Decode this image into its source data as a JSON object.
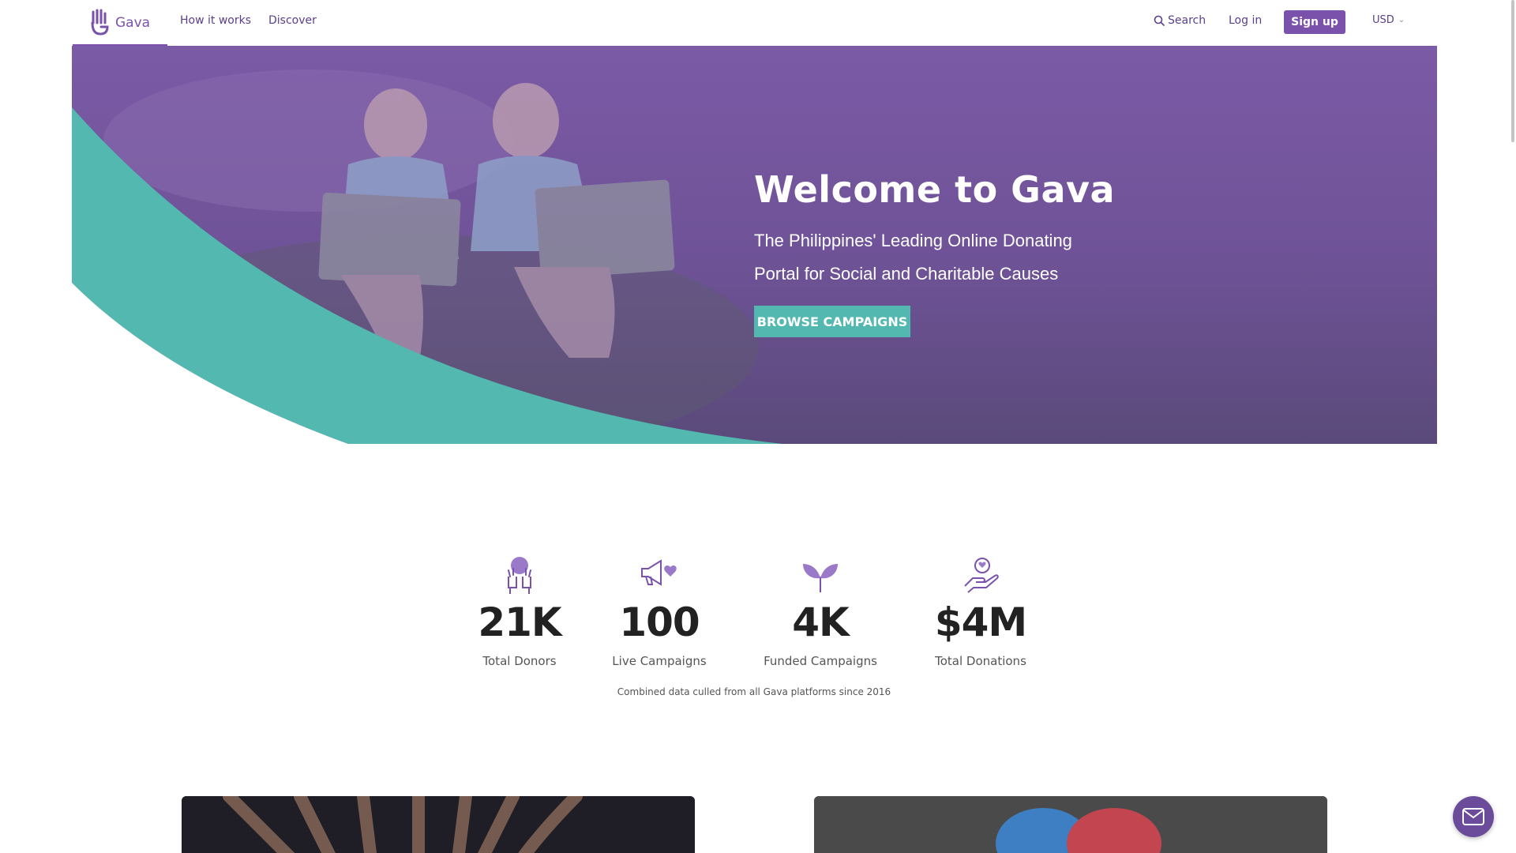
{
  "nav": {
    "logo_text": "Gava",
    "how_it_works": "How it works",
    "discover": "Discover",
    "search": "Search",
    "login": "Log in",
    "signup": "Sign up",
    "currency": "USD"
  },
  "hero": {
    "title": "Welcome to Gava",
    "subtitle": "The Philippines' Leading Online Donating Portal for Social and Charitable Causes",
    "button": "BROWSE CAMPAIGNS"
  },
  "stats": {
    "items": [
      {
        "value": "21K",
        "label": "Total Donors",
        "icon": "raised-hands-icon"
      },
      {
        "value": "100",
        "label": "Live Campaigns",
        "icon": "megaphone-heart-icon"
      },
      {
        "value": "4K",
        "label": "Funded Campaigns",
        "icon": "sprout-icon"
      },
      {
        "value": "$4M",
        "label": "Total Donations",
        "icon": "hand-heart-icon"
      }
    ],
    "note": "Combined data culled from all Gava platforms since 2016"
  },
  "colors": {
    "brand_purple": "#7b52ab",
    "hero_purple": "#6b4c9a",
    "teal": "#52b8b0"
  }
}
